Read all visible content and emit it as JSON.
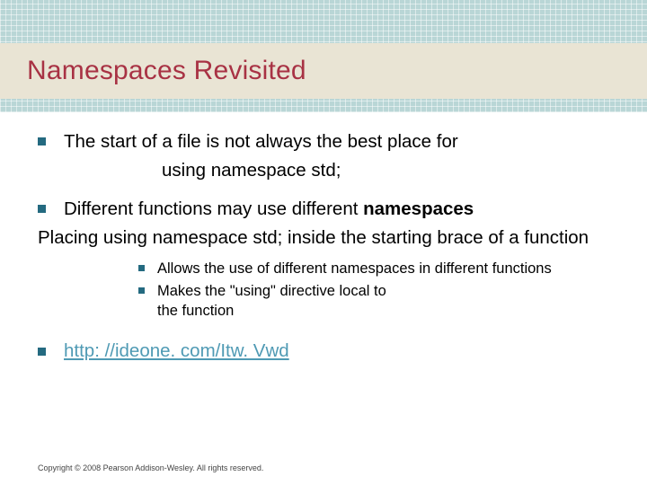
{
  "title": "Namespaces Revisited",
  "bullets": {
    "b1_line1": "The start of a file is not always the best place for",
    "b1_sub": "using namespace std;",
    "b2": "Different functions may use different ",
    "b2_bold": "namespaces",
    "para": "Placing  using namespace std; inside the starting brace of a function",
    "sub1": "Allows the use of different namespaces in different functions",
    "sub2_a": "Makes the \"using\" directive local to",
    "sub2_b": "the function",
    "link": "http: //ideone. com/Itw. Vwd"
  },
  "footer": "Copyright © 2008 Pearson Addison-Wesley.  All rights reserved."
}
